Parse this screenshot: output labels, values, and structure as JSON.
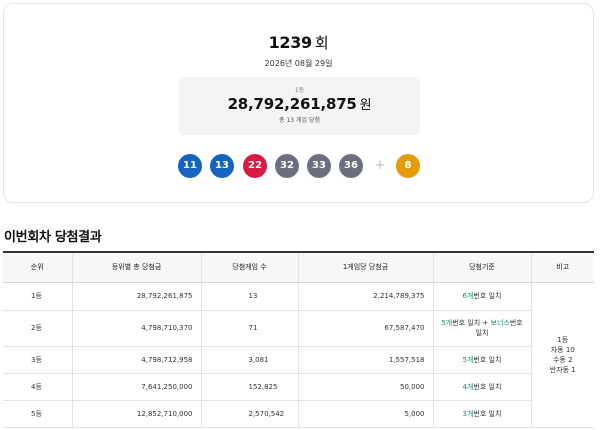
{
  "draw": {
    "round_number": "1239",
    "round_unit": "회",
    "date": "2026년 08월 29일"
  },
  "prize": {
    "rank_label": "1등",
    "amount": "28,792,261,875",
    "amount_unit": "원",
    "winners_text": "총 13 게임 당첨"
  },
  "balls": [
    {
      "number": "11",
      "color": "#1565c0"
    },
    {
      "number": "13",
      "color": "#1565c0"
    },
    {
      "number": "22",
      "color": "#d81b43"
    },
    {
      "number": "32",
      "color": "#6b6f7d"
    },
    {
      "number": "33",
      "color": "#6b6f7d"
    },
    {
      "number": "36",
      "color": "#6b6f7d"
    }
  ],
  "plus_symbol": "+",
  "bonus_ball": {
    "number": "8",
    "color": "#e39c0a"
  },
  "results": {
    "title": "이번회차 당첨결과",
    "headers": [
      "순위",
      "등위별 총 당첨금",
      "당첨게임 수",
      "1게임당 당첨금",
      "당첨기준",
      "비고"
    ],
    "rows": [
      {
        "rank": "1등",
        "total": "28,792,261,875",
        "count": "13",
        "per_game": "2,214,789,375",
        "criteria_hl": "6개",
        "criteria_text": "번호 일치"
      },
      {
        "rank": "2등",
        "total": "4,798,710,370",
        "count": "71",
        "per_game": "67,587,470",
        "criteria_hl": "5개",
        "criteria_text": "번호 일치 + ",
        "criteria_hl2": "보너스",
        "criteria_text2": "번호",
        "criteria_text3": "일치"
      },
      {
        "rank": "3등",
        "total": "4,798,712,958",
        "count": "3,081",
        "per_game": "1,557,518",
        "criteria_hl": "5개",
        "criteria_text": "번호 일치"
      },
      {
        "rank": "4등",
        "total": "7,641,250,000",
        "count": "152,825",
        "per_game": "50,000",
        "criteria_hl": "4개",
        "criteria_text": "번호 일치"
      },
      {
        "rank": "5등",
        "total": "12,852,710,000",
        "count": "2,570,542",
        "per_game": "5,000",
        "criteria_hl": "3개",
        "criteria_text": "번호 일치"
      }
    ],
    "note": {
      "line1": "1등",
      "line2": "자동 10",
      "line3": "수동 2",
      "line4": "반자동 1"
    }
  }
}
